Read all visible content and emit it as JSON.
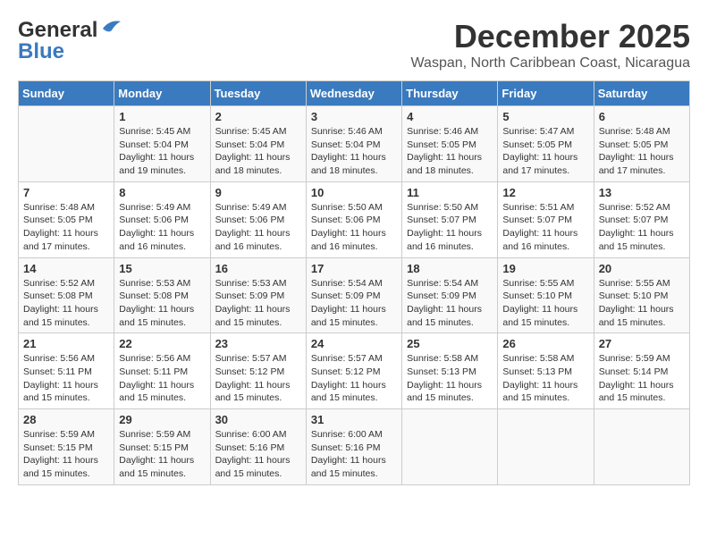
{
  "header": {
    "logo_general": "General",
    "logo_blue": "Blue",
    "month_year": "December 2025",
    "location": "Waspan, North Caribbean Coast, Nicaragua"
  },
  "days_of_week": [
    "Sunday",
    "Monday",
    "Tuesday",
    "Wednesday",
    "Thursday",
    "Friday",
    "Saturday"
  ],
  "weeks": [
    [
      {
        "day": "",
        "info": ""
      },
      {
        "day": "1",
        "info": "Sunrise: 5:45 AM\nSunset: 5:04 PM\nDaylight: 11 hours\nand 19 minutes."
      },
      {
        "day": "2",
        "info": "Sunrise: 5:45 AM\nSunset: 5:04 PM\nDaylight: 11 hours\nand 18 minutes."
      },
      {
        "day": "3",
        "info": "Sunrise: 5:46 AM\nSunset: 5:04 PM\nDaylight: 11 hours\nand 18 minutes."
      },
      {
        "day": "4",
        "info": "Sunrise: 5:46 AM\nSunset: 5:05 PM\nDaylight: 11 hours\nand 18 minutes."
      },
      {
        "day": "5",
        "info": "Sunrise: 5:47 AM\nSunset: 5:05 PM\nDaylight: 11 hours\nand 17 minutes."
      },
      {
        "day": "6",
        "info": "Sunrise: 5:48 AM\nSunset: 5:05 PM\nDaylight: 11 hours\nand 17 minutes."
      }
    ],
    [
      {
        "day": "7",
        "info": "Sunrise: 5:48 AM\nSunset: 5:05 PM\nDaylight: 11 hours\nand 17 minutes."
      },
      {
        "day": "8",
        "info": "Sunrise: 5:49 AM\nSunset: 5:06 PM\nDaylight: 11 hours\nand 16 minutes."
      },
      {
        "day": "9",
        "info": "Sunrise: 5:49 AM\nSunset: 5:06 PM\nDaylight: 11 hours\nand 16 minutes."
      },
      {
        "day": "10",
        "info": "Sunrise: 5:50 AM\nSunset: 5:06 PM\nDaylight: 11 hours\nand 16 minutes."
      },
      {
        "day": "11",
        "info": "Sunrise: 5:50 AM\nSunset: 5:07 PM\nDaylight: 11 hours\nand 16 minutes."
      },
      {
        "day": "12",
        "info": "Sunrise: 5:51 AM\nSunset: 5:07 PM\nDaylight: 11 hours\nand 16 minutes."
      },
      {
        "day": "13",
        "info": "Sunrise: 5:52 AM\nSunset: 5:07 PM\nDaylight: 11 hours\nand 15 minutes."
      }
    ],
    [
      {
        "day": "14",
        "info": "Sunrise: 5:52 AM\nSunset: 5:08 PM\nDaylight: 11 hours\nand 15 minutes."
      },
      {
        "day": "15",
        "info": "Sunrise: 5:53 AM\nSunset: 5:08 PM\nDaylight: 11 hours\nand 15 minutes."
      },
      {
        "day": "16",
        "info": "Sunrise: 5:53 AM\nSunset: 5:09 PM\nDaylight: 11 hours\nand 15 minutes."
      },
      {
        "day": "17",
        "info": "Sunrise: 5:54 AM\nSunset: 5:09 PM\nDaylight: 11 hours\nand 15 minutes."
      },
      {
        "day": "18",
        "info": "Sunrise: 5:54 AM\nSunset: 5:09 PM\nDaylight: 11 hours\nand 15 minutes."
      },
      {
        "day": "19",
        "info": "Sunrise: 5:55 AM\nSunset: 5:10 PM\nDaylight: 11 hours\nand 15 minutes."
      },
      {
        "day": "20",
        "info": "Sunrise: 5:55 AM\nSunset: 5:10 PM\nDaylight: 11 hours\nand 15 minutes."
      }
    ],
    [
      {
        "day": "21",
        "info": "Sunrise: 5:56 AM\nSunset: 5:11 PM\nDaylight: 11 hours\nand 15 minutes."
      },
      {
        "day": "22",
        "info": "Sunrise: 5:56 AM\nSunset: 5:11 PM\nDaylight: 11 hours\nand 15 minutes."
      },
      {
        "day": "23",
        "info": "Sunrise: 5:57 AM\nSunset: 5:12 PM\nDaylight: 11 hours\nand 15 minutes."
      },
      {
        "day": "24",
        "info": "Sunrise: 5:57 AM\nSunset: 5:12 PM\nDaylight: 11 hours\nand 15 minutes."
      },
      {
        "day": "25",
        "info": "Sunrise: 5:58 AM\nSunset: 5:13 PM\nDaylight: 11 hours\nand 15 minutes."
      },
      {
        "day": "26",
        "info": "Sunrise: 5:58 AM\nSunset: 5:13 PM\nDaylight: 11 hours\nand 15 minutes."
      },
      {
        "day": "27",
        "info": "Sunrise: 5:59 AM\nSunset: 5:14 PM\nDaylight: 11 hours\nand 15 minutes."
      }
    ],
    [
      {
        "day": "28",
        "info": "Sunrise: 5:59 AM\nSunset: 5:15 PM\nDaylight: 11 hours\nand 15 minutes."
      },
      {
        "day": "29",
        "info": "Sunrise: 5:59 AM\nSunset: 5:15 PM\nDaylight: 11 hours\nand 15 minutes."
      },
      {
        "day": "30",
        "info": "Sunrise: 6:00 AM\nSunset: 5:16 PM\nDaylight: 11 hours\nand 15 minutes."
      },
      {
        "day": "31",
        "info": "Sunrise: 6:00 AM\nSunset: 5:16 PM\nDaylight: 11 hours\nand 15 minutes."
      },
      {
        "day": "",
        "info": ""
      },
      {
        "day": "",
        "info": ""
      },
      {
        "day": "",
        "info": ""
      }
    ]
  ]
}
